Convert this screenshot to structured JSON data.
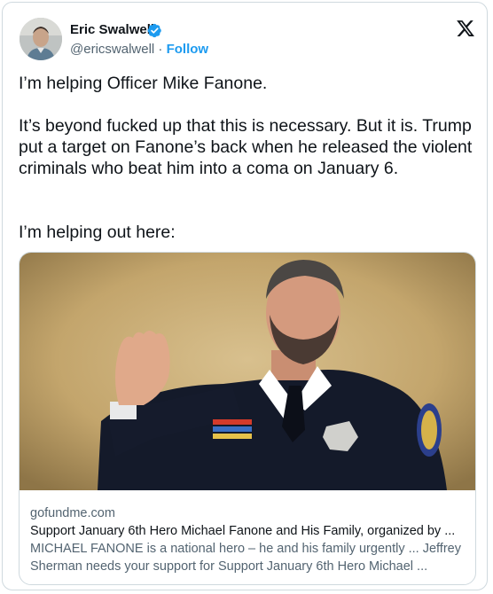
{
  "author": {
    "name": "Eric Swalwell",
    "handle": "@ericswalwell",
    "separator": "·",
    "follow_label": "Follow"
  },
  "tweet": {
    "line1": "I’m helping Officer Mike Fanone.",
    "para2": "It’s beyond fucked up that this is necessary. But it is. Trump put a target on Fanone’s back when he released the violent criminals who beat him into a coma on January 6.",
    "line3": "I’m helping out here:"
  },
  "link_card": {
    "domain": "gofundme.com",
    "title": "Support January 6th Hero Michael Fanone and His Family, organized by ...",
    "description": "MICHAEL FANONE is a national hero – he and his family urgently ... Jeffrey Sherman needs your support for Support January 6th Hero Michael ..."
  },
  "icons": {
    "verified": "verified-badge-icon",
    "platform": "x-logo-icon"
  },
  "colors": {
    "accent": "#1d9bf0",
    "text": "#0f1419",
    "muted": "#536471",
    "border": "#cfd9de"
  }
}
